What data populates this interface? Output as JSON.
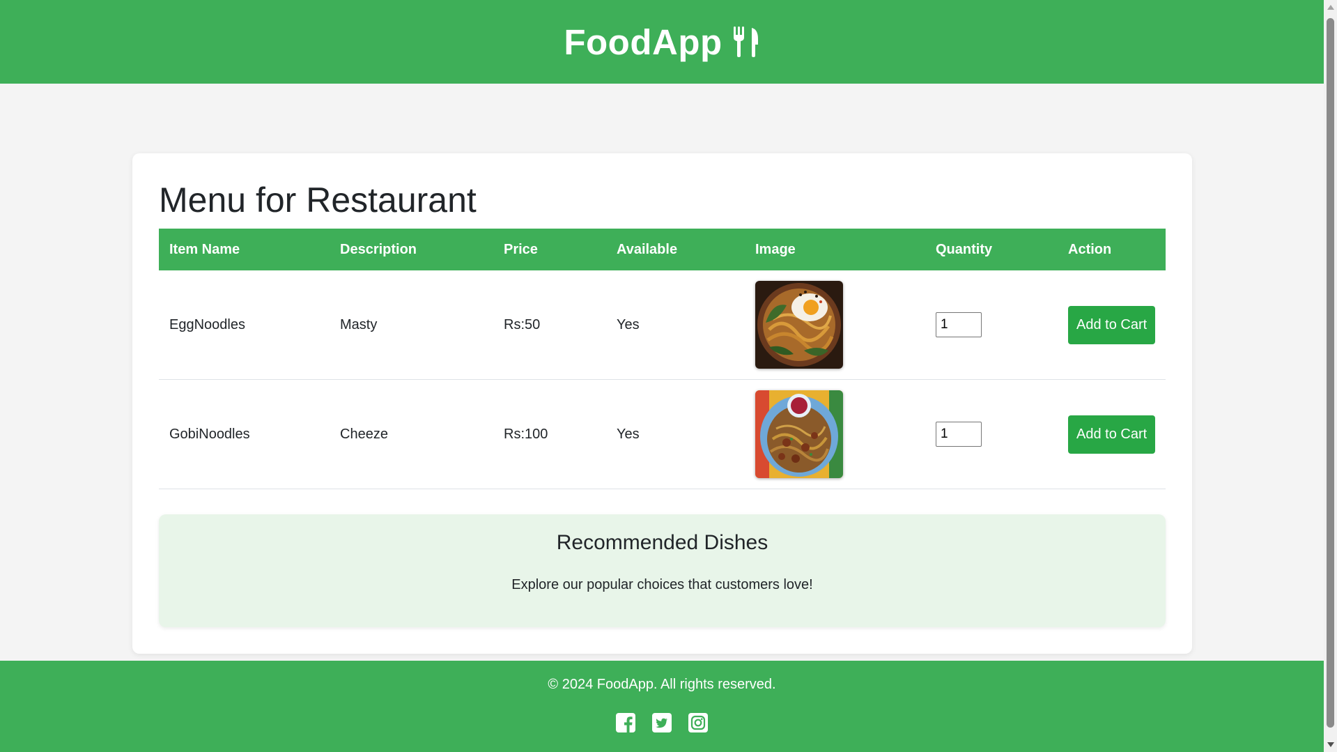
{
  "header": {
    "brand": "FoodApp",
    "brand_icon": "utensils-icon",
    "bg_color": "#3eaf58"
  },
  "main": {
    "title": "Menu for Restaurant",
    "table": {
      "columns": [
        "Item Name",
        "Description",
        "Price",
        "Available",
        "Image",
        "Quantity",
        "Action"
      ],
      "rows": [
        {
          "name": "EggNoodles",
          "description": "Masty",
          "price": "Rs:50",
          "available": "Yes",
          "image": "egg-noodles-photo",
          "quantity": "1",
          "action": "Add to Cart"
        },
        {
          "name": "GobiNoodles",
          "description": "Cheeze",
          "price": "Rs:100",
          "available": "Yes",
          "image": "gobi-noodles-photo",
          "quantity": "1",
          "action": "Add to Cart"
        }
      ]
    },
    "recommended": {
      "title": "Recommended Dishes",
      "text": "Explore our popular choices that customers love!"
    }
  },
  "footer": {
    "copyright": "© 2024 FoodApp. All rights reserved.",
    "social": [
      "facebook-icon",
      "twitter-icon",
      "instagram-icon"
    ]
  },
  "colors": {
    "accent": "#3eaf58",
    "button": "#28a745",
    "recommend_bg": "#e8f5e9"
  }
}
